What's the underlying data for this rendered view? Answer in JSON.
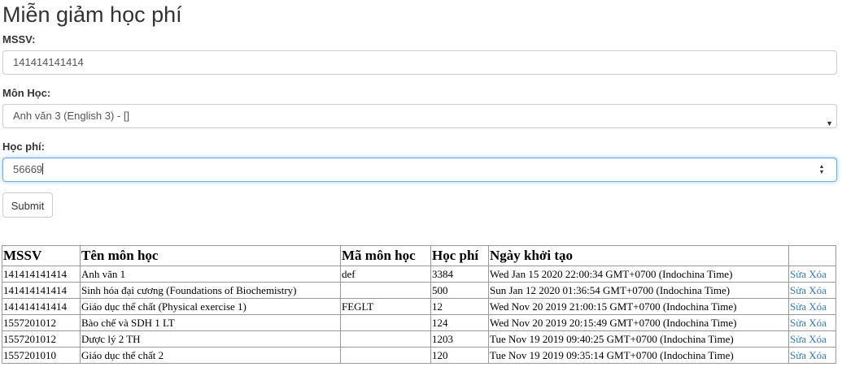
{
  "page": {
    "title": "Miễn giảm học phí"
  },
  "form": {
    "mssv_label": "MSSV:",
    "mssv_value": "141414141414",
    "mon_hoc_label": "Môn Học:",
    "mon_hoc_selected": "Anh văn 3 (English 3) - []",
    "hoc_phi_label": "Học phí:",
    "hoc_phi_value": "56669",
    "submit_label": "Submit"
  },
  "table": {
    "headers": [
      "MSSV",
      "Tên môn học",
      "Mã môn học",
      "Học phí",
      "Ngày khởi tạo",
      ""
    ],
    "rows": [
      {
        "mssv": "141414141414",
        "ten": "Anh văn 1",
        "ma": "def",
        "hocphi": "3384",
        "ngay": "Wed Jan 15 2020 22:00:34 GMT+0700 (Indochina Time)",
        "sua": "Sửa",
        "xoa": "Xóa"
      },
      {
        "mssv": "141414141414",
        "ten": "Sinh hóa đại cương (Foundations of Biochemistry)",
        "ma": "",
        "hocphi": "500",
        "ngay": "Sun Jan 12 2020 01:36:54 GMT+0700 (Indochina Time)",
        "sua": "Sửa",
        "xoa": "Xóa"
      },
      {
        "mssv": "141414141414",
        "ten": "Giáo dục thể chất (Physical exercise 1)",
        "ma": "FEGLT",
        "hocphi": "12",
        "ngay": "Wed Nov 20 2019 21:00:15 GMT+0700 (Indochina Time)",
        "sua": "Sửa",
        "xoa": "Xóa"
      },
      {
        "mssv": "1557201012",
        "ten": "Bào chế và SDH 1 LT",
        "ma": "",
        "hocphi": "124",
        "ngay": "Wed Nov 20 2019 20:15:49 GMT+0700 (Indochina Time)",
        "sua": "Sửa",
        "xoa": "Xóa"
      },
      {
        "mssv": "1557201012",
        "ten": "Dược lý 2 TH",
        "ma": "",
        "hocphi": "1203",
        "ngay": "Tue Nov 19 2019 09:40:25 GMT+0700 (Indochina Time)",
        "sua": "Sửa",
        "xoa": "Xóa"
      },
      {
        "mssv": "1557201010",
        "ten": "Giáo dục thể chất 2",
        "ma": "",
        "hocphi": "120",
        "ngay": "Tue Nov 19 2019 09:35:14 GMT+0700 (Indochina Time)",
        "sua": "Sửa",
        "xoa": "Xóa"
      }
    ]
  },
  "colors": {
    "link": "#337ab7",
    "focus_border": "#66afe9",
    "border": "#cccccc"
  },
  "icons": {
    "select": "chevron-down-icon",
    "spinner_up": "spinner-up-icon",
    "spinner_down": "spinner-down-icon"
  }
}
